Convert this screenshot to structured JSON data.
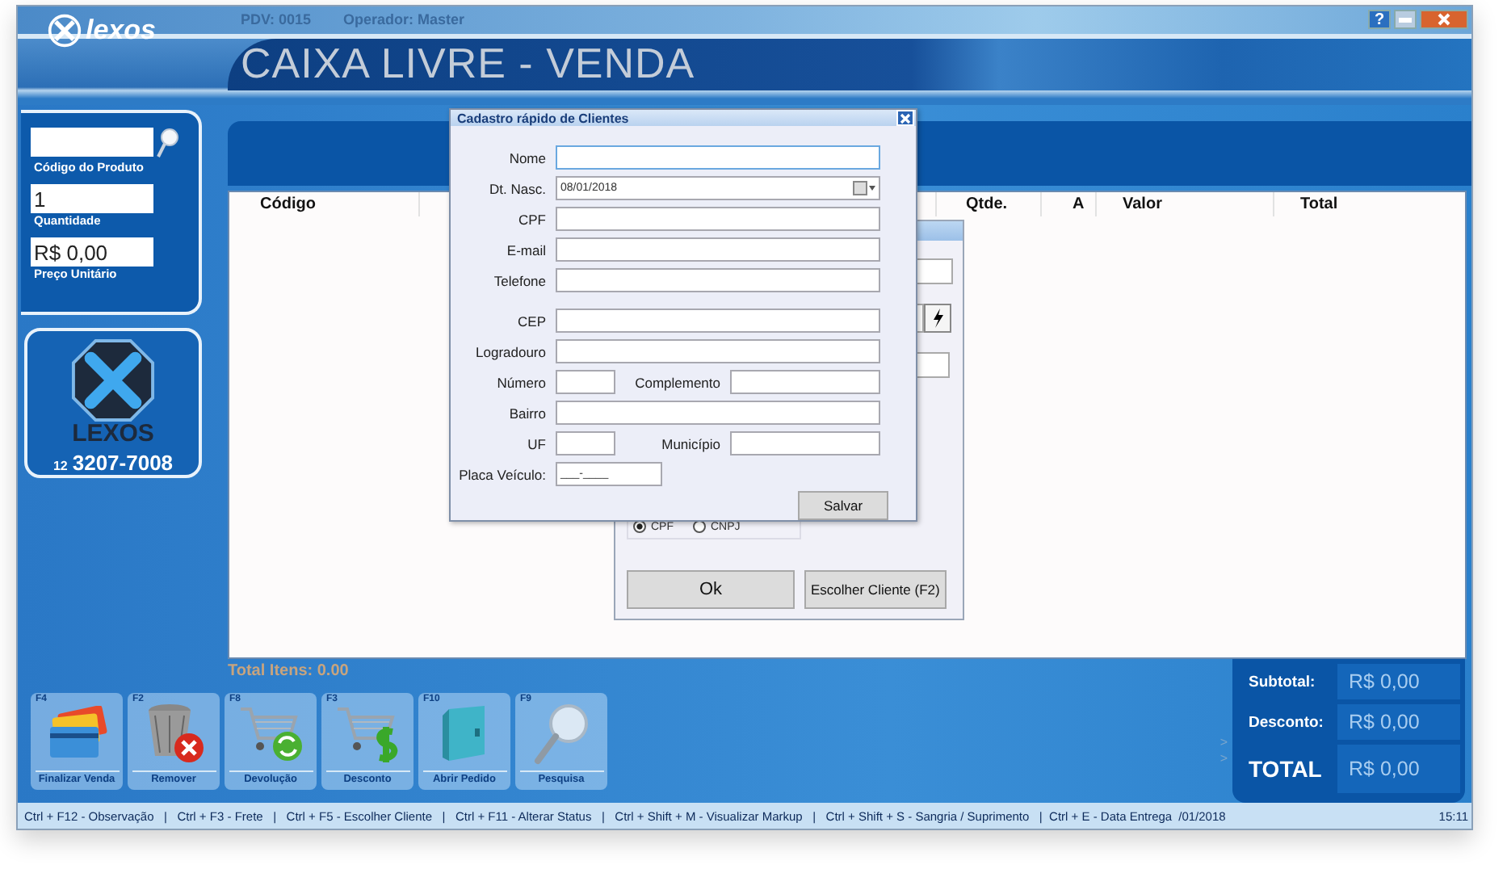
{
  "window": {
    "logo": "lexos",
    "pdv": "PDV: 0015",
    "operator": "Operador: Master",
    "title": "CAIXA LIVRE - VENDA",
    "help": "?"
  },
  "product_panel": {
    "fields": [
      {
        "label": "Código do Produto",
        "search": true
      },
      {
        "label": "Quantidade",
        "value": "1",
        "search": false
      },
      {
        "label": "Preço Unitário",
        "value": "R$ 0,00",
        "search": false
      }
    ]
  },
  "brand_card": {
    "name": "LEXOS",
    "area_code": "12",
    "phone": "3207-7008"
  },
  "table": {
    "columns": [
      {
        "label": "Código",
        "kind": "code"
      },
      {
        "label": "Qtde.",
        "kind": "qty"
      },
      {
        "label": "A",
        "kind": "flag"
      },
      {
        "label": "Valor",
        "kind": "price"
      },
      {
        "label": "Total",
        "kind": "total"
      }
    ]
  },
  "total_items": "Total Itens: 0.00",
  "actions": [
    {
      "key": "F4",
      "label": "Finalizar Venda",
      "kind": "cards"
    },
    {
      "key": "F2",
      "label": "Remover",
      "kind": "trash"
    },
    {
      "key": "F8",
      "label": "Devolução",
      "kind": "cart-return"
    },
    {
      "key": "F3",
      "label": "Desconto",
      "kind": "cart-discount"
    },
    {
      "key": "F10",
      "label": "Abrir Pedido",
      "kind": "book"
    },
    {
      "key": "F9",
      "label": "Pesquisa",
      "kind": "search"
    }
  ],
  "totals": {
    "arrows": [
      ">",
      ">"
    ],
    "rows": [
      {
        "label": "Subtotal:",
        "value": "R$ 0,00",
        "kind": "normal"
      },
      {
        "label": "Desconto:",
        "value": "R$ 0,00",
        "kind": "normal"
      },
      {
        "label": "TOTAL",
        "value": "R$ 0,00",
        "kind": "grand"
      }
    ]
  },
  "status_bar": {
    "shortcuts": "Ctrl + F12 - Observação   |   Ctrl + F3 - Frete   |   Ctrl + F5 - Escolher Cliente   |   Ctrl + F11 - Alterar Status   |   Ctrl + Shift + M - Visualizar Markup   |   Ctrl + Shift + S - Sangria / Suprimento   |  Ctrl + E - Data Entrega",
    "date": "/01/2018",
    "time": "15:11"
  },
  "customer_dialog": {
    "options": [
      {
        "label": "CPF",
        "selected": true
      },
      {
        "label": "CNPJ",
        "selected": false
      }
    ],
    "buttons": [
      {
        "label": "Ok",
        "kind": "wide"
      },
      {
        "label": "Escolher Cliente (F2)",
        "kind": "normal"
      }
    ]
  },
  "quick_register": {
    "title": "Cadastro rápido de Clientes",
    "save_button": "Salvar",
    "sections": [
      {
        "rows": [
          {
            "fields": [
              {
                "label": "Nome",
                "kind": "text",
                "focused": true
              }
            ]
          },
          {
            "fields": [
              {
                "label": "Dt. Nasc.",
                "kind": "date",
                "value": "08/01/2018",
                "focused": false
              }
            ]
          },
          {
            "fields": [
              {
                "label": "CPF",
                "kind": "text",
                "focused": false
              }
            ]
          },
          {
            "fields": [
              {
                "label": "E-mail",
                "kind": "text",
                "focused": false
              }
            ]
          },
          {
            "fields": [
              {
                "label": "Telefone",
                "kind": "text",
                "focused": false
              }
            ]
          }
        ]
      },
      {
        "rows": [
          {
            "fields": [
              {
                "label": "CEP",
                "kind": "text",
                "focused": false
              }
            ]
          },
          {
            "fields": [
              {
                "label": "Logradouro",
                "kind": "text",
                "focused": false
              }
            ]
          },
          {
            "fields": [
              {
                "label": "Número",
                "kind": "text",
                "focused": false
              },
              {
                "label": "Complemento",
                "kind": "text",
                "focused": false
              }
            ]
          },
          {
            "fields": [
              {
                "label": "Bairro",
                "kind": "text",
                "focused": false
              }
            ]
          },
          {
            "fields": [
              {
                "label": "UF",
                "kind": "text",
                "focused": false
              },
              {
                "label": "Município",
                "kind": "text",
                "focused": false
              }
            ]
          },
          {
            "fields": [
              {
                "label": "Placa Veículo:",
                "kind": "mask",
                "value": "___-____",
                "focused": false
              }
            ]
          }
        ]
      }
    ]
  }
}
